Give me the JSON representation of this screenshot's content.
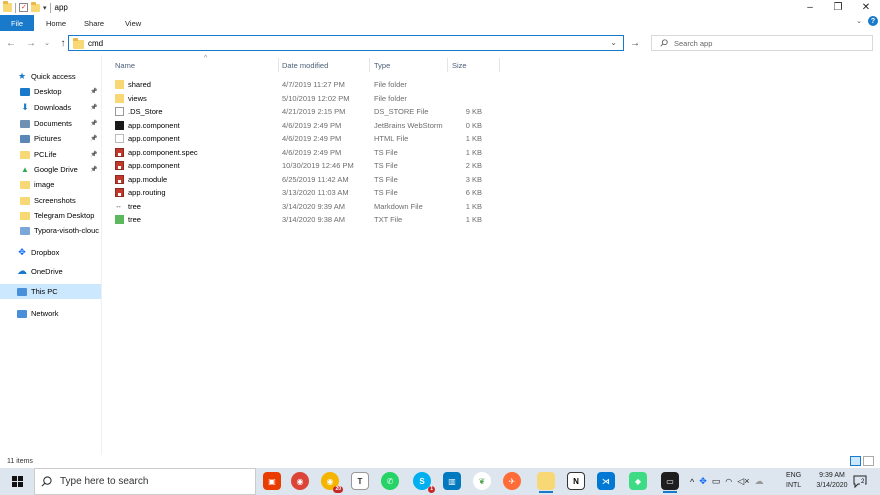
{
  "window": {
    "title": "app",
    "controls": {
      "minimize": "–",
      "maximize": "❐",
      "close": "✕"
    }
  },
  "ribbon": {
    "tabs": [
      "File",
      "Home",
      "Share",
      "View"
    ],
    "expand_icon": "chevron-down-icon",
    "help": "?"
  },
  "address": {
    "value": "cmd",
    "search_placeholder": "Search app"
  },
  "nav_pane": [
    {
      "label": "Quick access",
      "icon": "star-icon",
      "pinned": false
    },
    {
      "label": "Desktop",
      "icon": "desktop-icon",
      "pinned": true
    },
    {
      "label": "Downloads",
      "icon": "download-icon",
      "pinned": true
    },
    {
      "label": "Documents",
      "icon": "documents-icon",
      "pinned": true
    },
    {
      "label": "Pictures",
      "icon": "pictures-icon",
      "pinned": true
    },
    {
      "label": "PCLife",
      "icon": "folder-icon",
      "pinned": true
    },
    {
      "label": "Google Drive",
      "icon": "google-drive-icon",
      "pinned": true
    },
    {
      "label": "image",
      "icon": "folder-icon",
      "pinned": false
    },
    {
      "label": "Screenshots",
      "icon": "folder-icon",
      "pinned": false
    },
    {
      "label": "Telegram Desktop",
      "icon": "folder-icon",
      "pinned": false
    },
    {
      "label": "Typora-visoth-clouc",
      "icon": "image-icon",
      "pinned": false
    },
    {
      "label": "Dropbox",
      "icon": "dropbox-icon",
      "pinned": false
    },
    {
      "label": "OneDrive",
      "icon": "cloud-icon",
      "pinned": false
    },
    {
      "label": "This PC",
      "icon": "monitor-icon",
      "pinned": false,
      "selected": true
    },
    {
      "label": "Network",
      "icon": "network-icon",
      "pinned": false
    }
  ],
  "columns": [
    "Name",
    "Date modified",
    "Type",
    "Size"
  ],
  "files": [
    {
      "name": "shared",
      "date": "4/7/2019 11:27 PM",
      "type": "File folder",
      "size": "",
      "icon": "folder-icon"
    },
    {
      "name": "views",
      "date": "5/10/2019 12:02 PM",
      "type": "File folder",
      "size": "",
      "icon": "folder-icon"
    },
    {
      "name": ".DS_Store",
      "date": "4/21/2019 2:15 PM",
      "type": "DS_STORE File",
      "size": "9 KB",
      "icon": "blank-file-icon"
    },
    {
      "name": "app.component",
      "date": "4/6/2019 2:49 PM",
      "type": "JetBrains WebStorm",
      "size": "0 KB",
      "icon": "webstorm-icon"
    },
    {
      "name": "app.component",
      "date": "4/6/2019 2:49 PM",
      "type": "HTML File",
      "size": "1 KB",
      "icon": "html-file-icon"
    },
    {
      "name": "app.component.spec",
      "date": "4/6/2019 2:49 PM",
      "type": "TS File",
      "size": "1 KB",
      "icon": "ts-file-icon"
    },
    {
      "name": "app.component",
      "date": "10/30/2019 12:46 PM",
      "type": "TS File",
      "size": "2 KB",
      "icon": "ts-file-icon"
    },
    {
      "name": "app.module",
      "date": "6/25/2019 11:42 AM",
      "type": "TS File",
      "size": "3 KB",
      "icon": "ts-file-icon"
    },
    {
      "name": "app.routing",
      "date": "3/13/2020 11:03 AM",
      "type": "TS File",
      "size": "6 KB",
      "icon": "ts-file-icon"
    },
    {
      "name": "tree",
      "date": "3/14/2020 9:39 AM",
      "type": "Markdown File",
      "size": "1 KB",
      "icon": "markdown-file-icon"
    },
    {
      "name": "tree",
      "date": "3/14/2020 9:38 AM",
      "type": "TXT File",
      "size": "1 KB",
      "icon": "txt-file-icon"
    }
  ],
  "status": {
    "count": "11 items"
  },
  "taskbar": {
    "search_placeholder": "Type here to search",
    "apps": [
      "office-icon",
      "chrome-icon",
      "chrome-canary-icon",
      "typora-icon",
      "whatsapp-icon",
      "skype-icon",
      "trello-icon",
      "mongodb-icon",
      "postman-icon",
      "file-explorer-icon",
      "notion-icon",
      "vscode-icon",
      "android-studio-icon",
      "terminal-icon"
    ],
    "skype_badge": "1",
    "chrome_badge": "20",
    "tray": [
      "chevron-up-icon",
      "dropbox-icon",
      "keyboard-icon",
      "wifi-icon",
      "volume-icon",
      "onedrive-icon"
    ],
    "lang_top": "ENG",
    "lang_bottom": "INTL",
    "time": "9:39 AM",
    "date": "3/14/2020",
    "notifications": "2"
  },
  "colors": {
    "accent": "#1979ca",
    "folder": "#f8d775",
    "selection": "#cce8ff",
    "taskbar": "#dde6ef"
  }
}
